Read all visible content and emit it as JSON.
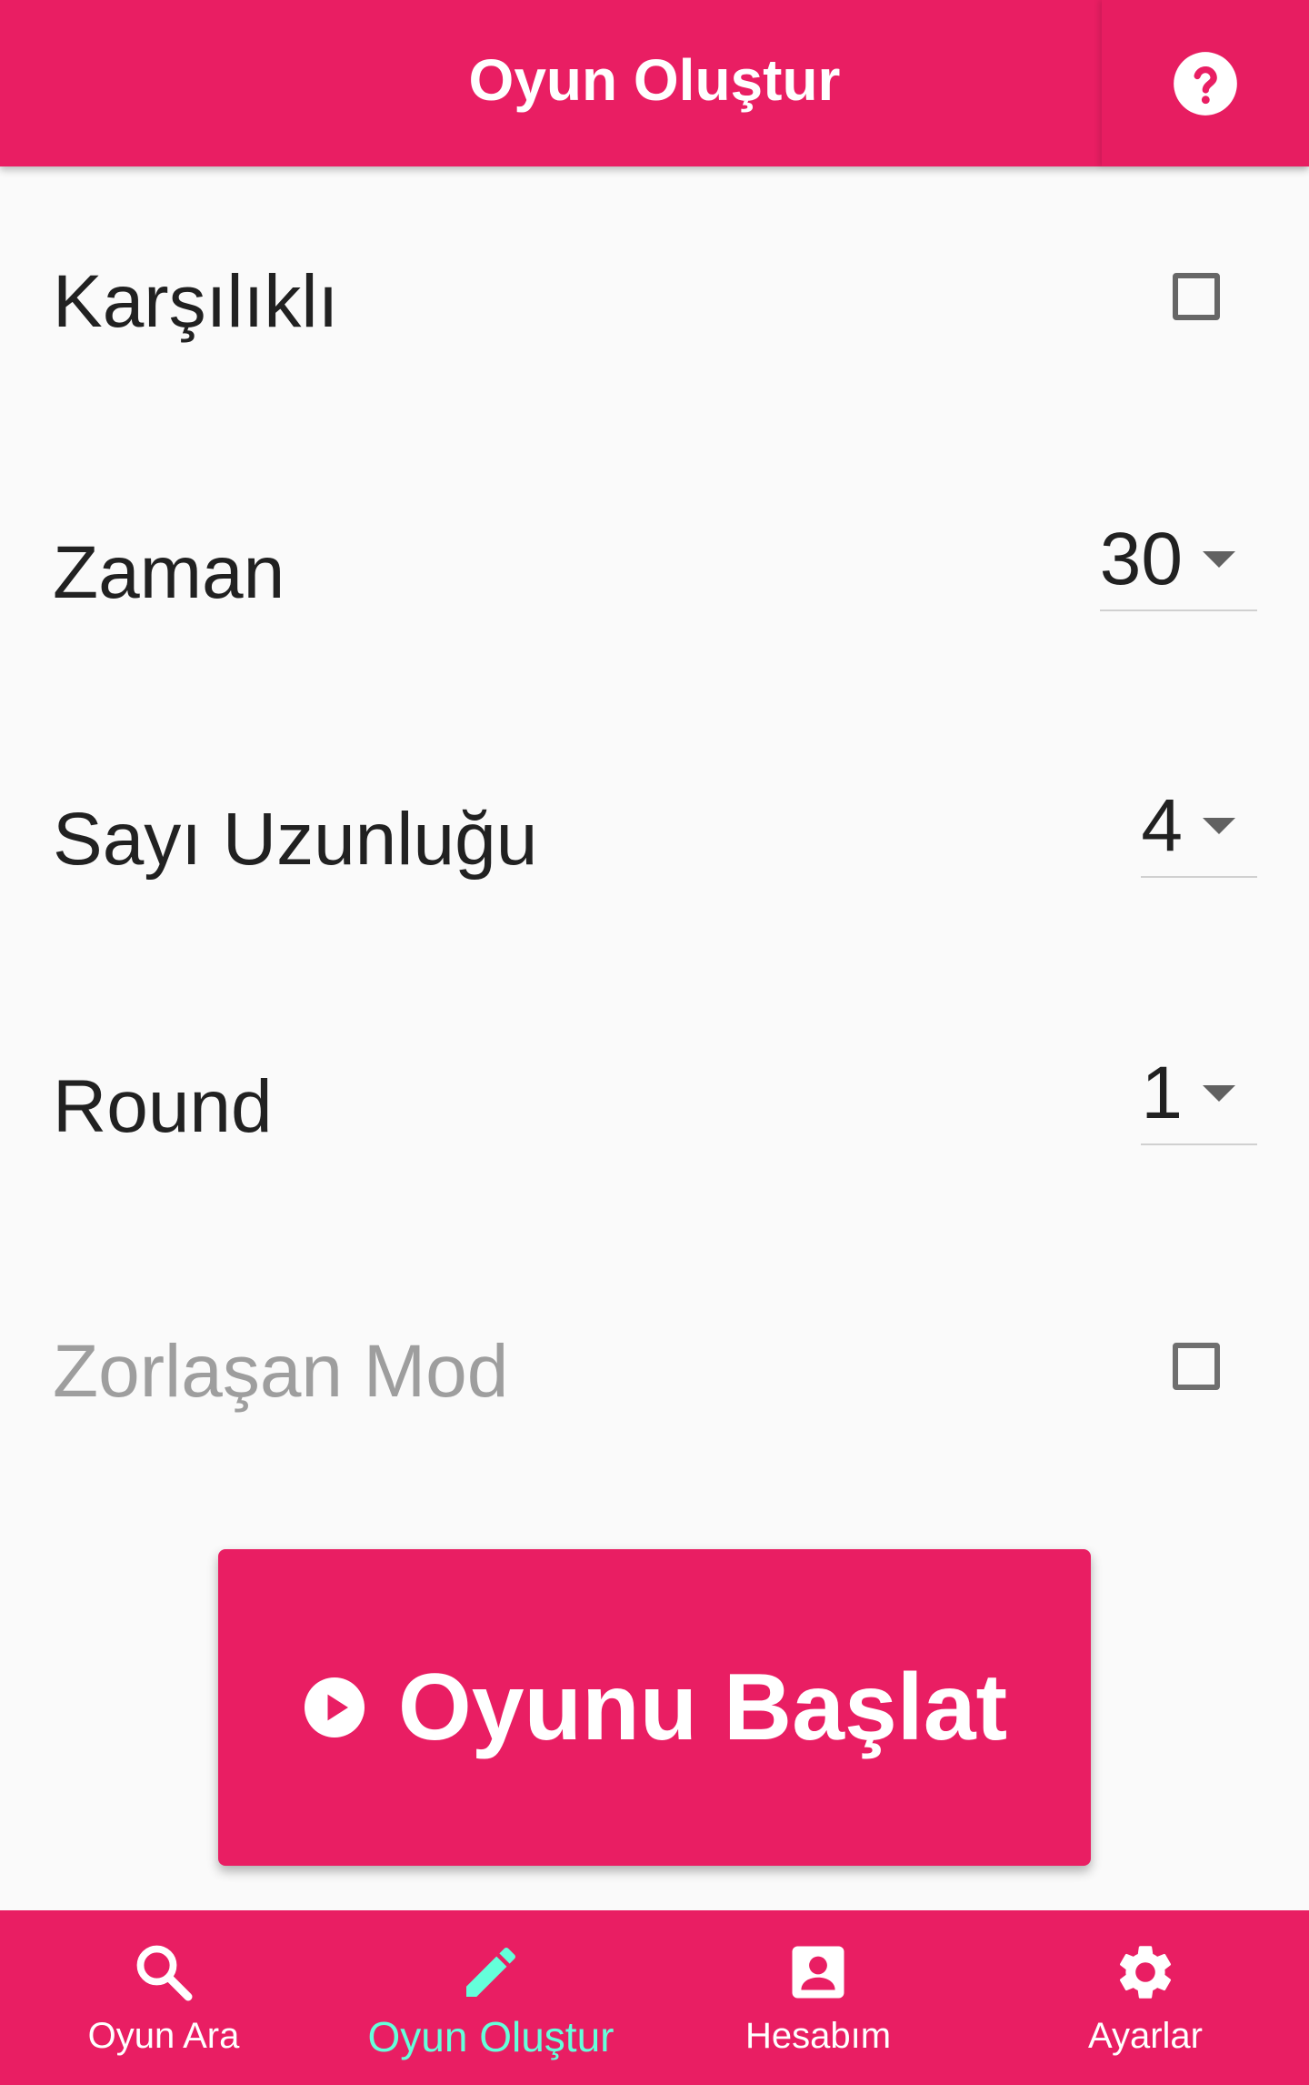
{
  "header": {
    "title": "Oyun Oluştur",
    "help_icon": "help-circle-icon"
  },
  "settings": {
    "karsilikli": {
      "label": "Karşılıklı",
      "checked": false
    },
    "zaman": {
      "label": "Zaman",
      "value": "30"
    },
    "sayi_uzunlugu": {
      "label": "Sayı Uzunluğu",
      "value": "4"
    },
    "round": {
      "label": "Round",
      "value": "1"
    },
    "zorlasan_mod": {
      "label": "Zorlaşan Mod",
      "checked": false,
      "disabled": true
    }
  },
  "start_button": {
    "label": "Oyunu Başlat",
    "icon": "play-circle-icon"
  },
  "bottom_nav": {
    "items": [
      {
        "label": "Oyun Ara",
        "icon": "search-icon",
        "active": false
      },
      {
        "label": "Oyun Oluştur",
        "icon": "pencil-icon",
        "active": true
      },
      {
        "label": "Hesabım",
        "icon": "account-box-icon",
        "active": false
      },
      {
        "label": "Ayarlar",
        "icon": "gear-icon",
        "active": false
      }
    ]
  },
  "colors": {
    "primary": "#e91e63",
    "nav_active": "#64ffda",
    "text": "#212121",
    "disabled_text": "#9e9e9e"
  }
}
